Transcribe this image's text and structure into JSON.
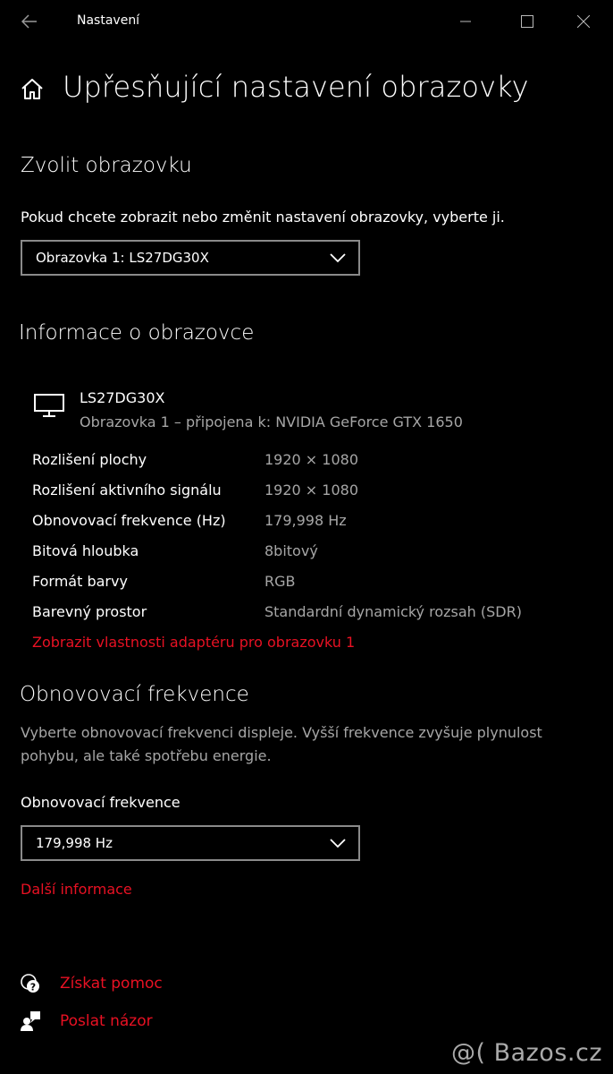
{
  "window": {
    "title": "Nastavení"
  },
  "page": {
    "title": "Upřesňující nastavení obrazovky"
  },
  "choose_display": {
    "heading": "Zvolit obrazovku",
    "description": "Pokud chcete zobrazit nebo změnit nastavení obrazovky, vyberte ji.",
    "selected": "Obrazovka 1: LS27DG30X"
  },
  "display_info": {
    "heading": "Informace o obrazovce",
    "monitor_name": "LS27DG30X",
    "monitor_subtitle": "Obrazovka 1 – připojena k: NVIDIA GeForce GTX 1650",
    "rows": [
      {
        "label": "Rozlišení plochy",
        "value": "1920 × 1080"
      },
      {
        "label": "Rozlišení aktivního signálu",
        "value": "1920 × 1080"
      },
      {
        "label": "Obnovovací frekvence (Hz)",
        "value": "179,998 Hz"
      },
      {
        "label": "Bitová hloubka",
        "value": "8bitový"
      },
      {
        "label": "Formát barvy",
        "value": "RGB"
      },
      {
        "label": "Barevný prostor",
        "value": "Standardní dynamický rozsah (SDR)"
      }
    ],
    "adapter_link": "Zobrazit vlastnosti adaptéru pro obrazovku 1"
  },
  "refresh_rate": {
    "heading": "Obnovovací frekvence",
    "description_line1": "Vyberte obnovovací frekvenci displeje. Vyšší frekvence zvyšuje plynulost",
    "description_line2": "pohybu, ale také spotřebu energie.",
    "field_label": "Obnovovací frekvence",
    "selected": "179,998 Hz",
    "more_info_link": "Další informace"
  },
  "help": {
    "get_help": "Získat pomoc",
    "feedback": "Poslat názor"
  },
  "watermark": "@( Bazos.cz",
  "colors": {
    "accent": "#e81123",
    "background": "#000000",
    "muted_text": "#a6a6a6"
  },
  "icons": [
    "back-arrow-icon",
    "minimize-icon",
    "maximize-icon",
    "close-icon",
    "home-icon",
    "chevron-down-icon",
    "monitor-icon",
    "help-icon",
    "feedback-icon"
  ]
}
